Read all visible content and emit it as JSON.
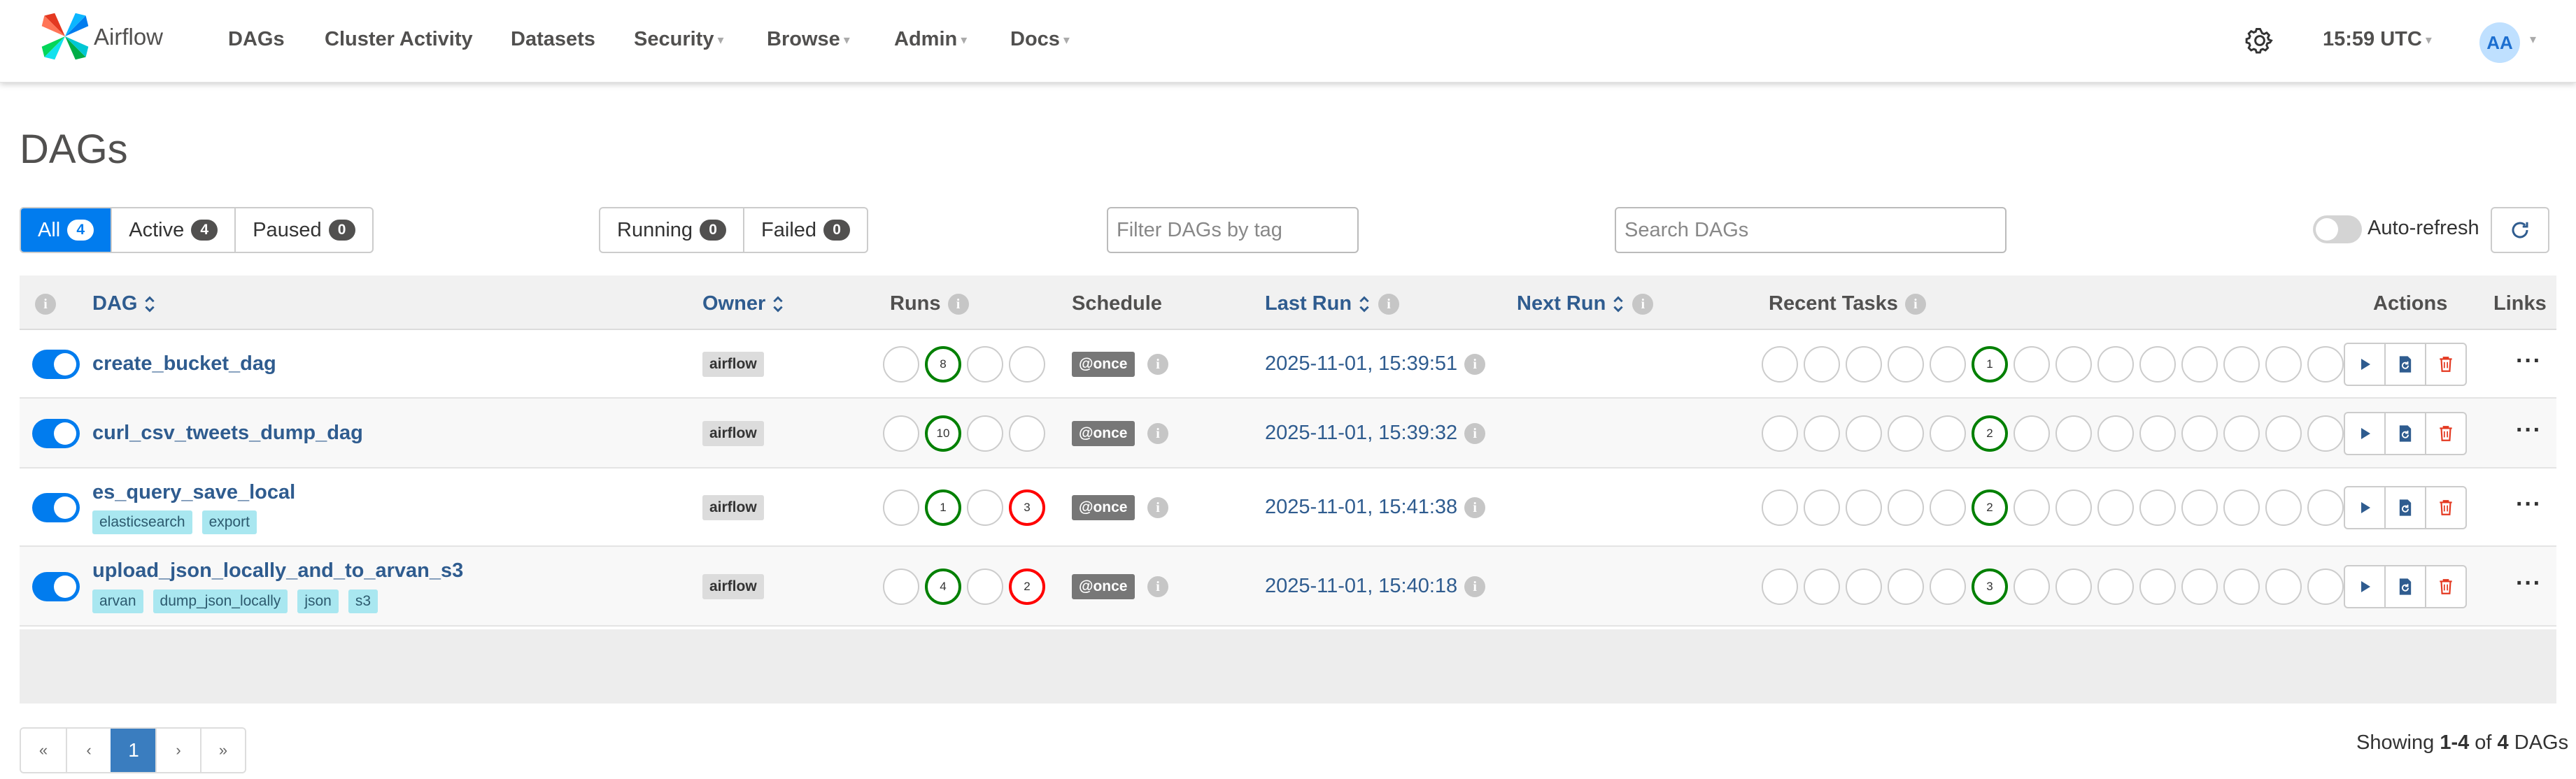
{
  "nav": {
    "brand": "Airflow",
    "items": [
      {
        "label": "DAGs",
        "dropdown": false
      },
      {
        "label": "Cluster Activity",
        "dropdown": false
      },
      {
        "label": "Datasets",
        "dropdown": false
      },
      {
        "label": "Security",
        "dropdown": true
      },
      {
        "label": "Browse",
        "dropdown": true
      },
      {
        "label": "Admin",
        "dropdown": true
      },
      {
        "label": "Docs",
        "dropdown": true
      }
    ],
    "time": "15:59 UTC",
    "avatar": "AA"
  },
  "page": {
    "title": "DAGs"
  },
  "filters": {
    "status": [
      {
        "label": "All",
        "count": "4",
        "active": true
      },
      {
        "label": "Active",
        "count": "4",
        "active": false
      },
      {
        "label": "Paused",
        "count": "0",
        "active": false
      }
    ],
    "runs": [
      {
        "label": "Running",
        "count": "0"
      },
      {
        "label": "Failed",
        "count": "0"
      }
    ],
    "tag_placeholder": "Filter DAGs by tag",
    "search_placeholder": "Search DAGs",
    "auto_refresh_label": "Auto-refresh",
    "auto_refresh_on": false
  },
  "table": {
    "headers": {
      "dag": "DAG",
      "owner": "Owner",
      "runs": "Runs",
      "schedule": "Schedule",
      "last_run": "Last Run",
      "next_run": "Next Run",
      "recent_tasks": "Recent Tasks",
      "actions": "Actions",
      "links": "Links"
    },
    "rows": [
      {
        "dag_id": "create_bucket_dag",
        "tags": [],
        "owner": "airflow",
        "runs": [
          "",
          "8",
          "",
          ""
        ],
        "schedule": "@once",
        "last_run": "2025-11-01, 15:39:51",
        "recent_task_success": "1",
        "enabled": true
      },
      {
        "dag_id": "curl_csv_tweets_dump_dag",
        "tags": [],
        "owner": "airflow",
        "runs": [
          "",
          "10",
          "",
          ""
        ],
        "schedule": "@once",
        "last_run": "2025-11-01, 15:39:32",
        "recent_task_success": "2",
        "enabled": true
      },
      {
        "dag_id": "es_query_save_local",
        "tags": [
          "elasticsearch",
          "export"
        ],
        "owner": "airflow",
        "runs": [
          "",
          "1",
          "",
          "3"
        ],
        "schedule": "@once",
        "last_run": "2025-11-01, 15:41:38",
        "recent_task_success": "2",
        "enabled": true
      },
      {
        "dag_id": "upload_json_locally_and_to_arvan_s3",
        "tags": [
          "arvan",
          "dump_json_locally",
          "json",
          "s3"
        ],
        "owner": "airflow",
        "runs": [
          "",
          "4",
          "",
          "2"
        ],
        "schedule": "@once",
        "last_run": "2025-11-01, 15:40:18",
        "recent_task_success": "3",
        "enabled": true
      }
    ],
    "run_states": [
      "queued",
      "success",
      "running",
      "failed"
    ],
    "recent_task_states": 14,
    "recent_task_success_index": 5
  },
  "pagination": {
    "buttons": [
      "«",
      "‹",
      "1",
      "›",
      "»"
    ],
    "current": "1",
    "showing_prefix": "Showing ",
    "showing_range": "1-4",
    "showing_mid": " of ",
    "showing_total": "4",
    "showing_suffix": " DAGs"
  },
  "colors": {
    "primary": "#017cee",
    "success": "#008000",
    "failed": "#ff0000",
    "link": "#2f5c8f"
  }
}
